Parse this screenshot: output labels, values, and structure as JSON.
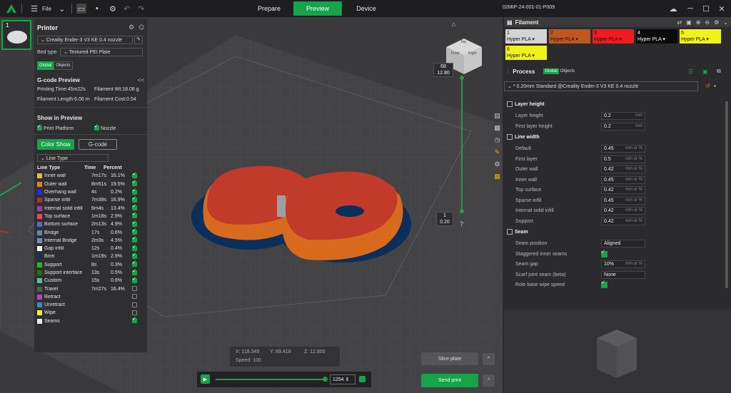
{
  "topbar": {
    "file_label": "File",
    "tabs": [
      {
        "label": "Prepare",
        "active": false
      },
      {
        "label": "Preview",
        "active": true
      },
      {
        "label": "Device",
        "active": false
      }
    ],
    "serial": "02MIP-24-001-01-P009"
  },
  "plate": {
    "number": "1"
  },
  "printer": {
    "title": "Printer",
    "printer_name": "Creality Ender-3 V3 KE 0.4 nozzle",
    "bed_type_label": "Bed type",
    "bed_type_value": "Textured PEI Plate",
    "toggle": [
      "Global",
      "Objects"
    ]
  },
  "gcode_preview": {
    "title": "G-code Preview",
    "collapse": "<<",
    "printing_time": "Printing Time:45m22s",
    "filament_wt": "Filament Wt:18.08 g",
    "filament_length": "Filament Length:6.06 m",
    "filament_cost": "Filament Cost:0.54",
    "show_in_preview": "Show in Preview",
    "print_platform": "Print Platform",
    "nozzle": "Nozzle",
    "color_show": "Color Show",
    "gcode_btn": "G-code",
    "line_type_dd": "Line Type",
    "headers": [
      "Line Type",
      "Time",
      "Percent"
    ],
    "rows": [
      {
        "name": "Inner wall",
        "time": "7m17s",
        "pct": "16.1%",
        "color": "#e6c02a",
        "checked": true
      },
      {
        "name": "Outer wall",
        "time": "8m51s",
        "pct": "19.5%",
        "color": "#f07a1b",
        "checked": true
      },
      {
        "name": "Overhang wall",
        "time": "4s",
        "pct": "0.2%",
        "color": "#1b2ff2",
        "checked": true
      },
      {
        "name": "Sparse infill",
        "time": "7m39s",
        "pct": "16.9%",
        "color": "#b5302a",
        "checked": true
      },
      {
        "name": "Internal solid infill",
        "time": "6m4s",
        "pct": "13.4%",
        "color": "#a33ca3",
        "checked": true
      },
      {
        "name": "Top surface",
        "time": "1m18s",
        "pct": "2.9%",
        "color": "#f04a4a",
        "checked": true
      },
      {
        "name": "Bottom surface",
        "time": "2m13s",
        "pct": "4.9%",
        "color": "#5a68c4",
        "checked": true
      },
      {
        "name": "Bridge",
        "time": "17s",
        "pct": "0.6%",
        "color": "#5a88b5",
        "checked": true
      },
      {
        "name": "Internal Bridge",
        "time": "2m3s",
        "pct": "4.5%",
        "color": "#7b8ec4",
        "checked": true
      },
      {
        "name": "Gap infill",
        "time": "12s",
        "pct": "0.4%",
        "color": "#f2f2f2",
        "checked": true
      },
      {
        "name": "Brim",
        "time": "1m19s",
        "pct": "2.9%",
        "color": "#0a3566",
        "checked": true
      },
      {
        "name": "Support",
        "time": "8s",
        "pct": "0.3%",
        "color": "#16c416",
        "checked": true
      },
      {
        "name": "Support interface",
        "time": "13s",
        "pct": "0.5%",
        "color": "#0f7a0f",
        "checked": true
      },
      {
        "name": "Custom",
        "time": "15s",
        "pct": "0.6%",
        "color": "#56c49a",
        "checked": true
      },
      {
        "name": "Travel",
        "time": "7m27s",
        "pct": "16.4%",
        "color": "#3a6e3a",
        "checked": false
      },
      {
        "name": "Retract",
        "time": "",
        "pct": "",
        "color": "#c43ac4",
        "checked": false
      },
      {
        "name": "Unretract",
        "time": "",
        "pct": "",
        "color": "#3a8ac4",
        "checked": false
      },
      {
        "name": "Wipe",
        "time": "",
        "pct": "",
        "color": "#f2f21b",
        "checked": false
      },
      {
        "name": "Seams",
        "time": "",
        "pct": "",
        "color": "#e8e8e8",
        "checked": true
      }
    ]
  },
  "viewport": {
    "top_label_a": "68",
    "top_label_b": "12.80",
    "bottom_label_a": "1",
    "bottom_label_b": "0.20",
    "cube_faces": [
      "Top",
      "Front",
      "Right"
    ]
  },
  "coords": {
    "x": "X: 118.345",
    "y": "Y: 89.418",
    "z": "Z: 12.800",
    "speed": "Speed: 100"
  },
  "slider": {
    "value": "1254"
  },
  "buttons": {
    "slice": "Slice plate",
    "send": "Send print",
    "up": "^"
  },
  "filament": {
    "title": "Filament",
    "items": [
      {
        "num": "1",
        "name": "Hyper PLA",
        "color": "#d4d4d4",
        "text": "#111111"
      },
      {
        "num": "2",
        "name": "Hyper PLA",
        "color": "#c0571e",
        "text": "#111111"
      },
      {
        "num": "3",
        "name": "Hyper PLA",
        "color": "#f21b1b",
        "text": "#111111"
      },
      {
        "num": "4",
        "name": "Hyper PLA",
        "color": "#0b0b0b",
        "text": "#ffffff"
      },
      {
        "num": "5",
        "name": "Hyper PLA",
        "color": "#f2f21b",
        "text": "#111111"
      },
      {
        "num": "6",
        "name": "Hyper PLA",
        "color": "#f2f21b",
        "text": "#111111"
      }
    ]
  },
  "process": {
    "title": "Process",
    "toggle": [
      "Global",
      "Objects"
    ],
    "preset": "* 0.20mm Standard @Creality Ender-3 V3 KE 0.4 nozzle",
    "sections": [
      {
        "title": "Layer height",
        "rows": [
          {
            "label": "Layer height",
            "value": "0.2",
            "unit": "mm"
          },
          {
            "label": "First layer height",
            "value": "0.2",
            "unit": "mm"
          }
        ]
      },
      {
        "title": "Line width",
        "rows": [
          {
            "label": "Default",
            "value": "0.45",
            "unit": "mm or %"
          },
          {
            "label": "First layer",
            "value": "0.5",
            "unit": "mm or %"
          },
          {
            "label": "Outer wall",
            "value": "0.42",
            "unit": "mm or %"
          },
          {
            "label": "Inner wall",
            "value": "0.45",
            "unit": "mm or %"
          },
          {
            "label": "Top surface",
            "value": "0.42",
            "unit": "mm or %"
          },
          {
            "label": "Sparse infill",
            "value": "0.45",
            "unit": "mm or %"
          },
          {
            "label": "Internal solid infill",
            "value": "0.42",
            "unit": "mm or %"
          },
          {
            "label": "Support",
            "value": "0.42",
            "unit": "mm or %"
          }
        ]
      },
      {
        "title": "Seam",
        "rows": [
          {
            "label": "Seam position",
            "value": "Aligned",
            "unit": ""
          },
          {
            "label": "Staggered inner seams",
            "value": "",
            "unit": "",
            "checkbox": true
          },
          {
            "label": "Seam gap",
            "value": "10%",
            "unit": "mm or %"
          },
          {
            "label": "Scarf joint seam (beta)",
            "value": "None",
            "unit": ""
          },
          {
            "label": "Role base wipe speed",
            "value": "",
            "unit": "",
            "checkbox": true
          }
        ]
      }
    ]
  },
  "colors": {
    "accent": "#16a34a"
  }
}
